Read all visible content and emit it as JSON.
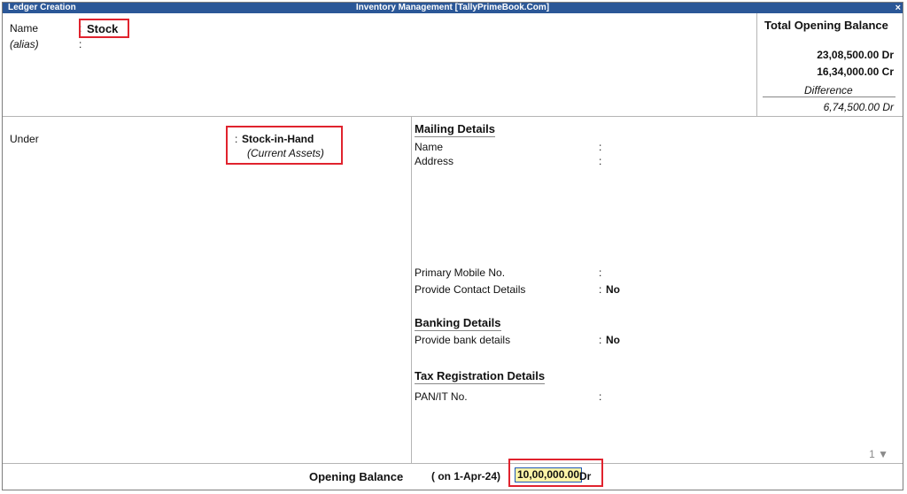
{
  "titlebar": {
    "left": "Ledger Creation",
    "center": "Inventory Management [TallyPrimeBook.Com]",
    "close": "×"
  },
  "header": {
    "name_label": "Name",
    "name_colon": ":",
    "name_value": "Stock",
    "alias_label": "(alias)",
    "alias_colon": ":"
  },
  "balance_panel": {
    "title": "Total Opening Balance",
    "debit": "23,08,500.00 Dr",
    "credit": "16,34,000.00 Cr",
    "difference_label": "Difference",
    "difference_value": "6,74,500.00 Dr"
  },
  "left_panel": {
    "under_label": "Under",
    "under_colon": ":",
    "under_value": "Stock-in-Hand",
    "under_group": "(Current Assets)"
  },
  "mailing": {
    "heading": "Mailing Details",
    "name_label": "Name",
    "name_colon": ":",
    "address_label": "Address",
    "address_colon": ":",
    "mobile_label": "Primary Mobile No.",
    "mobile_colon": ":",
    "contact_label": "Provide Contact Details",
    "contact_colon": ":",
    "contact_value": "No"
  },
  "banking": {
    "heading": "Banking Details",
    "bank_label": "Provide bank details",
    "bank_colon": ":",
    "bank_value": "No"
  },
  "tax": {
    "heading": "Tax Registration Details",
    "pan_label": "PAN/IT No.",
    "pan_colon": ":"
  },
  "page_indicator": "1 ▼",
  "footer": {
    "label": "Opening Balance",
    "date": "( on 1-Apr-24)",
    "amount": "10,00,000.00",
    "suffix": "Dr"
  }
}
